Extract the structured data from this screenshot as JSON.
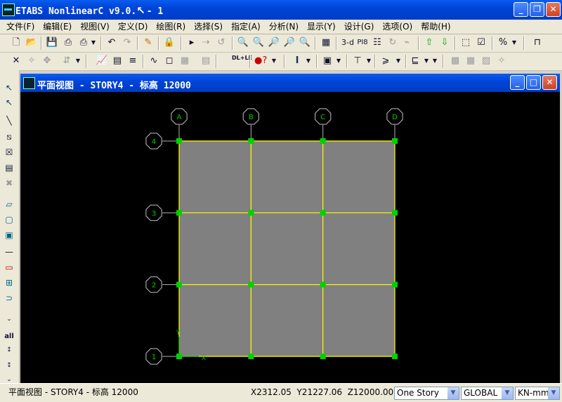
{
  "app": {
    "title": "ETABS NonlinearC v9.0.",
    "title_suffix": "- 1",
    "window_buttons": {
      "minimize": "_",
      "restore": "❐",
      "close": "✕"
    }
  },
  "menu": [
    {
      "label": "文件(F)"
    },
    {
      "label": "编辑(E)"
    },
    {
      "label": "视图(V)"
    },
    {
      "label": "定义(D)"
    },
    {
      "label": "绘图(R)"
    },
    {
      "label": "选择(S)"
    },
    {
      "label": "指定(A)"
    },
    {
      "label": "分析(N)"
    },
    {
      "label": "显示(Y)"
    },
    {
      "label": "设计(G)"
    },
    {
      "label": "选项(O)"
    },
    {
      "label": "帮助(H)"
    }
  ],
  "toolbar": {
    "view_3d_label": "3-d",
    "view_3d_alt": "PI8",
    "plane_button_label": "I",
    "dlle_label": "DL+LE"
  },
  "inner_window": {
    "title": "平面视图 - STORY4 - 标高 12000"
  },
  "grid": {
    "columns": [
      "A",
      "B",
      "C",
      "D"
    ],
    "rows": [
      "4",
      "3",
      "2",
      "1"
    ],
    "axis_x": "X",
    "axis_y": "Y"
  },
  "left_toolbar": {
    "all_label": "all"
  },
  "status": {
    "view_text": "平面视图 - STORY4 - 标高 12000",
    "coords": "X2312.05  Y21227.06  Z12000.00",
    "story_select": "One Story",
    "coord_system": "GLOBAL",
    "units": "KN-mm"
  },
  "colors": {
    "canvas_bg": "#000000",
    "slab": "#808080",
    "grid_line": "#ffff00",
    "bubble": "#c0c0c0",
    "point": "#00d000",
    "bubble_text": "#00d000"
  }
}
